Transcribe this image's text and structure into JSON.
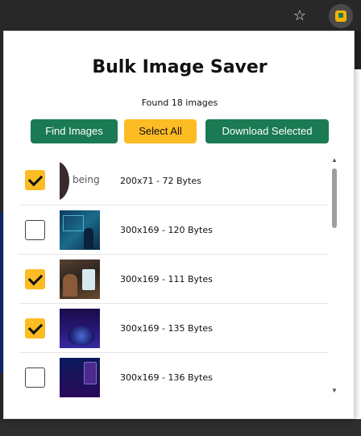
{
  "popup": {
    "title": "Bulk Image Saver",
    "status": "Found 18 images",
    "buttons": {
      "find": "Find Images",
      "select_all": "Select All",
      "download": "Download Selected"
    },
    "images": [
      {
        "label": "200x71 - 72 Bytes",
        "checked": true,
        "thumb_text": "being"
      },
      {
        "label": "300x169 - 120 Bytes",
        "checked": false
      },
      {
        "label": "300x169 - 111 Bytes",
        "checked": true
      },
      {
        "label": "300x169 - 135 Bytes",
        "checked": true
      },
      {
        "label": "300x169 - 136 Bytes",
        "checked": false
      }
    ]
  },
  "colors": {
    "primary_button": "#1a7a53",
    "accent_button": "#fdbb24",
    "checkbox_checked": "#fdbb24"
  },
  "icons": {
    "bookmark": "star-icon",
    "extension": "extension-icon"
  }
}
